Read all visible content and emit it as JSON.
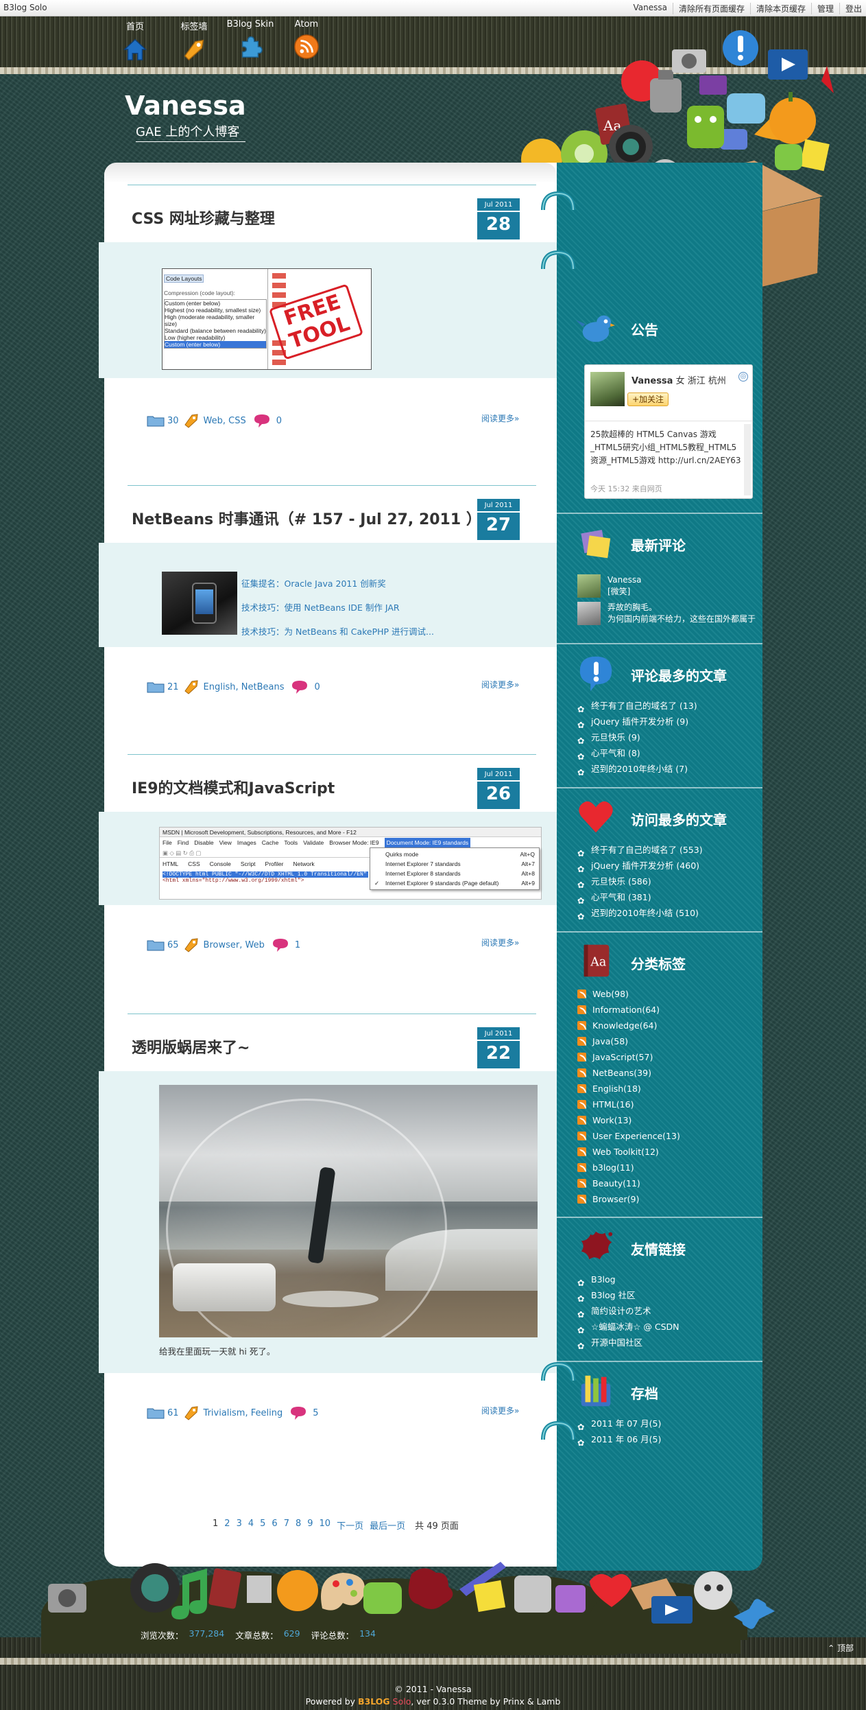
{
  "topbar": {
    "brand": "B3log Solo",
    "links": [
      "Vanessa",
      "清除所有页面缓存",
      "清除本页缓存",
      "管理",
      "登出"
    ]
  },
  "nav": [
    {
      "label": "首页",
      "icon": "home-icon"
    },
    {
      "label": "标签墙",
      "icon": "tag-icon"
    },
    {
      "label": "B3log Skin",
      "icon": "puzzle-icon"
    },
    {
      "label": "Atom",
      "icon": "rss-icon"
    }
  ],
  "site": {
    "title": "Vanessa",
    "subtitle": "GAE 上的个人博客"
  },
  "posts": [
    {
      "title": "CSS 网址珍藏与整理",
      "month": "Jul 2011",
      "day": "28",
      "tag_count": "30",
      "tags": "Web, CSS",
      "comments": "0",
      "read_more": "阅读更多»",
      "preview": {
        "heading": "Code Layouts",
        "sub": "Compression (code layout):",
        "options": [
          "Custom (enter below)",
          "Highest (no readability, smallest size)",
          "High (moderate readability, smaller size)",
          "Standard (balance between readability)",
          "Low (higher readability)",
          "Custom (enter below)"
        ],
        "badge": "FREE TOOL"
      }
    },
    {
      "title": "NetBeans 时事通讯（# 157 - Jul 27, 2011 ）",
      "month": "Jul 2011",
      "day": "27",
      "tag_count": "21",
      "tags": "English, NetBeans",
      "comments": "0",
      "read_more": "阅读更多»",
      "bullets": [
        "征集提名：Oracle Java 2011 创新奖",
        "技术技巧：使用 NetBeans IDE 制作 JAR",
        "技术技巧：为 NetBeans 和 CakePHP 进行调试..."
      ]
    },
    {
      "title": "IE9的文档模式和JavaScript",
      "month": "Jul 2011",
      "day": "26",
      "tag_count": "65",
      "tags": "Browser, Web",
      "comments": "1",
      "read_more": "阅读更多»",
      "devtools": {
        "window_title": "MSDN | Microsoft Development, Subscriptions, Resources, and More - F12",
        "menu": [
          "File",
          "Find",
          "Disable",
          "View",
          "Images",
          "Cache",
          "Tools",
          "Validate",
          "Browser Mode: IE9",
          "Document Mode: IE9 standards"
        ],
        "tabs": [
          "HTML",
          "CSS",
          "Console",
          "Script",
          "Profiler",
          "Network"
        ],
        "code": [
          "<!DOCTYPE html PUBLIC \"-//W3C//DTD XHTML 1.0 Transitional//EN\"",
          "<html xmlns=\"http://www.w3.org/1999/xhtml\">"
        ],
        "dropdown": [
          {
            "label": "Quirks mode",
            "key": "Alt+Q"
          },
          {
            "label": "Internet Explorer 7 standards",
            "key": "Alt+7"
          },
          {
            "label": "Internet Explorer 8 standards",
            "key": "Alt+8"
          },
          {
            "label": "Internet Explorer 9 standards (Page default)",
            "key": "Alt+9"
          }
        ]
      }
    },
    {
      "title": "透明版蜗居来了~",
      "month": "Jul 2011",
      "day": "22",
      "tag_count": "61",
      "tags": "Trivialism, Feeling",
      "comments": "5",
      "read_more": "阅读更多»",
      "caption": "给我在里面玩一天就 hi 死了。"
    }
  ],
  "pagination": {
    "pages": [
      "1",
      "2",
      "3",
      "4",
      "5",
      "6",
      "7",
      "8",
      "9",
      "10"
    ],
    "next": "下一页",
    "last": "最后一页",
    "total": "共 49 页面"
  },
  "sidebar": {
    "notice": {
      "title": "公告",
      "weibo": {
        "name": "Vanessa",
        "gender": "女",
        "location": "浙江 杭州",
        "follow": "+加关注",
        "text": "25款超棒的 HTML5 Canvas 游戏_HTML5研究小组_HTML5教程_HTML5资源_HTML5游戏 http://url.cn/2AEY63",
        "time": "今天 15:32 来自网页"
      }
    },
    "recent_comments": {
      "title": "最新评论",
      "items": [
        {
          "name": "Vanessa",
          "text": "[微笑]"
        },
        {
          "name": "弄故的胸毛。",
          "text": "为何国内前端不给力，这些在国外都属于"
        }
      ]
    },
    "most_commented": {
      "title": "评论最多的文章",
      "items": [
        "终于有了自己的域名了 (13)",
        "jQuery 插件开发分析 (9)",
        "元旦快乐 (9)",
        "心平气和 (8)",
        "迟到的2010年终小结 (7)"
      ]
    },
    "most_viewed": {
      "title": "访问最多的文章",
      "items": [
        "终于有了自己的域名了 (553)",
        "jQuery 插件开发分析 (460)",
        "元旦快乐 (586)",
        "心平气和 (381)",
        "迟到的2010年终小结 (510)"
      ]
    },
    "tags": {
      "title": "分类标签",
      "items": [
        "Web(98)",
        "Information(64)",
        "Knowledge(64)",
        "Java(58)",
        "JavaScript(57)",
        "NetBeans(39)",
        "English(18)",
        "HTML(16)",
        "Work(13)",
        "User Experience(13)",
        "Web Toolkit(12)",
        "b3log(11)",
        "Beauty(11)",
        "Browser(9)"
      ]
    },
    "links": {
      "title": "友情链接",
      "items": [
        "B3log",
        "B3log 社区",
        "简约设计の艺术",
        "☆蝙蝠冰涛☆ @ CSDN",
        "开源中国社区"
      ]
    },
    "archive": {
      "title": "存档",
      "items": [
        "2011 年 07 月(5)",
        "2011 年 06 月(5)"
      ]
    }
  },
  "footer": {
    "views_label": "浏览次数：",
    "views": "377,284",
    "articles_label": "文章总数：",
    "articles": "629",
    "comments_label": "评论总数：",
    "comments": "134",
    "top": "顶部",
    "copyright": "© 2011 - Vanessa",
    "powered_pre": "Powered by ",
    "powered_b3": "B3LOG",
    "powered_solo": " Solo",
    "powered_post": ", ver 0.3.0  Theme by Prinx & Lamb"
  },
  "colors": {
    "date_box": "#1a7c9f",
    "sidebar": "#0f7d8a",
    "band": "#e5f3f4",
    "link": "#2b78b5",
    "bg": "#274845"
  }
}
